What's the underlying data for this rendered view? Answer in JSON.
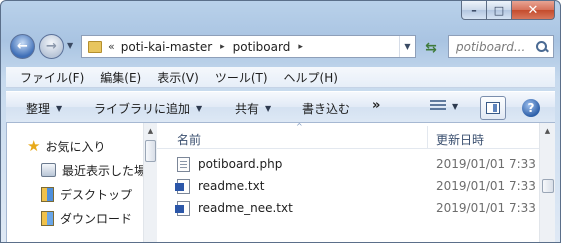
{
  "window": {
    "caption": {
      "minimize_glyph": "–",
      "maximize_glyph": "□",
      "close_glyph": "✕"
    }
  },
  "navigation": {
    "back_glyph": "←",
    "forward_glyph": "→",
    "address": {
      "overflow": "«",
      "segments": [
        "poti-kai-master",
        "potiboard"
      ],
      "separator": "▸"
    },
    "refresh_glyph": "⇆",
    "search": {
      "placeholder": "potiboard..."
    }
  },
  "menubar": {
    "items": [
      "ファイル(F)",
      "編集(E)",
      "表示(V)",
      "ツール(T)",
      "ヘルプ(H)"
    ]
  },
  "commandbar": {
    "items": [
      {
        "label": "整理",
        "dropdown": true
      },
      {
        "label": "ライブラリに追加",
        "dropdown": true
      },
      {
        "label": "共有",
        "dropdown": true
      },
      {
        "label": "書き込む",
        "dropdown": false
      }
    ],
    "more": "»",
    "help_glyph": "?"
  },
  "nav_pane": {
    "items": [
      {
        "label": "お気に入り",
        "icon": "star-icon"
      },
      {
        "label": "最近表示した場",
        "icon": "recent-places-icon"
      },
      {
        "label": "デスクトップ",
        "icon": "desktop-icon"
      },
      {
        "label": "ダウンロード",
        "icon": "downloads-icon"
      }
    ]
  },
  "file_list": {
    "headers": {
      "name": "名前",
      "date": "更新日時"
    },
    "sort_indicator": "^",
    "rows": [
      {
        "name": "potiboard.php",
        "date": "2019/01/01 7:33",
        "icon": "php-file-icon"
      },
      {
        "name": "readme.txt",
        "date": "2019/01/01 7:33",
        "icon": "text-file-icon"
      },
      {
        "name": "readme_nee.txt",
        "date": "2019/01/01 7:33",
        "icon": "text-file-icon"
      }
    ]
  }
}
